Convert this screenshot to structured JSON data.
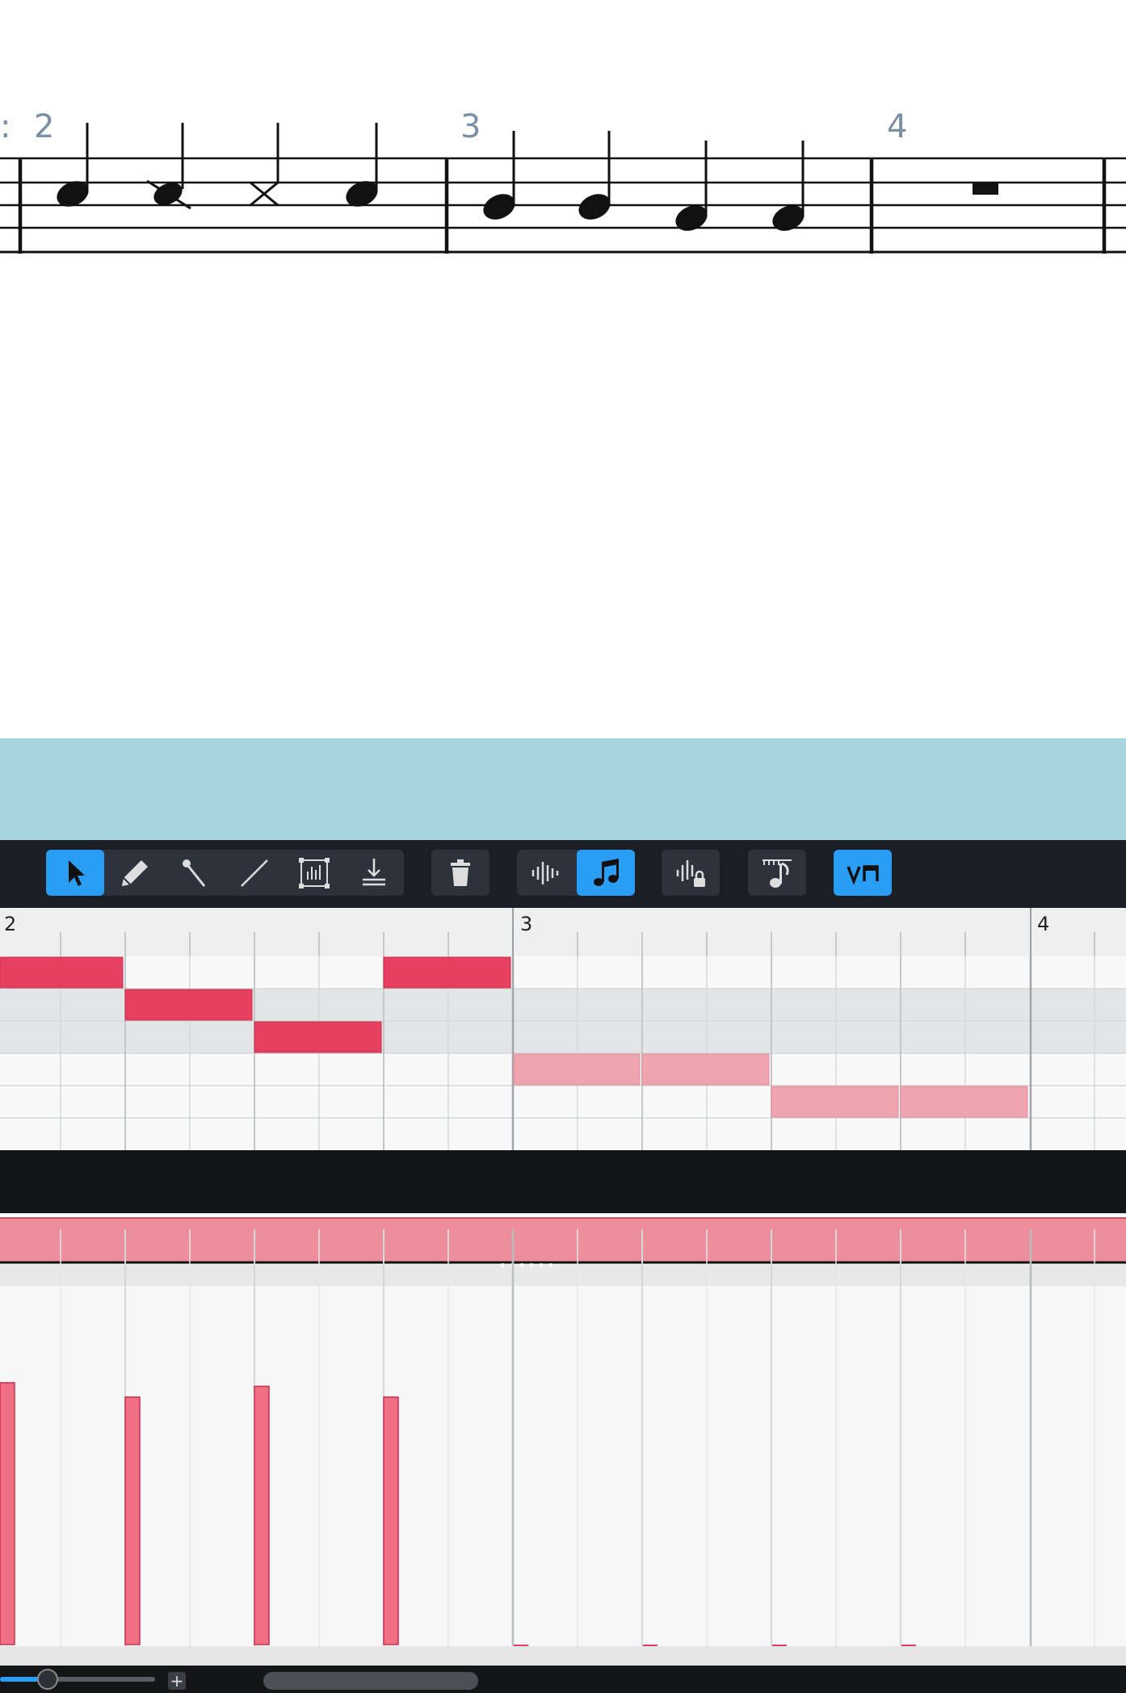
{
  "colors": {
    "note_active": "#e5405f",
    "note_dim": "#eea5b0",
    "accent": "#2a9df4",
    "band_bg": "#a7d5de",
    "toolbar_bg": "#1b1e25"
  },
  "score": {
    "measure_numbers": [
      "2",
      "3",
      "4"
    ]
  },
  "toolbar": {
    "tools": [
      {
        "id": "select",
        "icon": "pointer-icon",
        "active": true
      },
      {
        "id": "draw",
        "icon": "pencil-icon",
        "active": false
      },
      {
        "id": "line",
        "icon": "line-tool-icon",
        "active": false
      },
      {
        "id": "ramp",
        "icon": "diagonal-line-icon",
        "active": false
      },
      {
        "id": "transform",
        "icon": "transform-box-icon",
        "active": false
      },
      {
        "id": "stamp",
        "icon": "stamp-down-icon",
        "active": false
      },
      {
        "id": "delete",
        "icon": "trash-icon",
        "active": false
      },
      {
        "id": "audio",
        "icon": "waveform-icon",
        "active": false
      },
      {
        "id": "midi",
        "icon": "music-note-icon",
        "active": true
      },
      {
        "id": "lock",
        "icon": "waveform-lock-icon",
        "active": false
      },
      {
        "id": "quantize",
        "icon": "ruler-note-icon",
        "active": false
      },
      {
        "id": "articulation",
        "icon": "bow-marks-icon",
        "active": true
      }
    ]
  },
  "piano_roll": {
    "ruler_labels": [
      "2",
      "3",
      "4"
    ]
  },
  "velocity": {
    "values": [
      0.73,
      0.69,
      0.72,
      0.69
    ]
  }
}
